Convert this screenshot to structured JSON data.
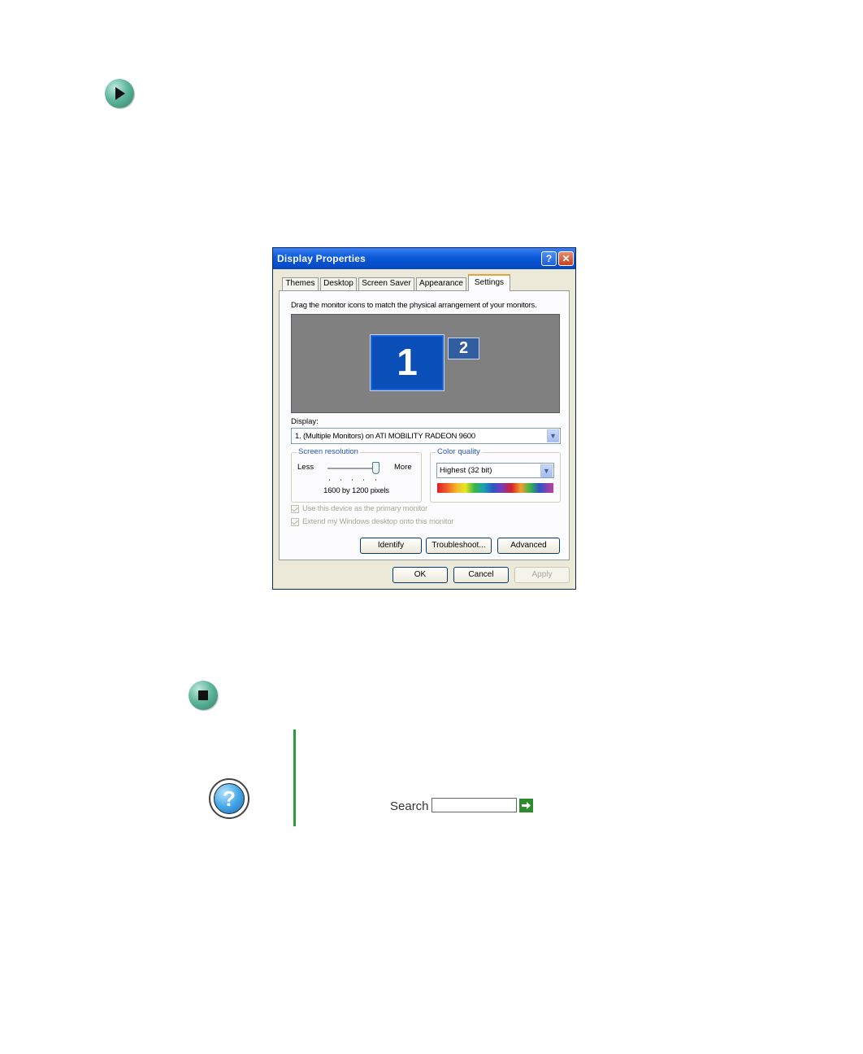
{
  "dialog": {
    "title": "Display Properties",
    "help_button": "?",
    "close_button": "✕",
    "tabs": [
      {
        "label": "Themes"
      },
      {
        "label": "Desktop"
      },
      {
        "label": "Screen Saver"
      },
      {
        "label": "Appearance"
      },
      {
        "label": "Settings",
        "active": true
      }
    ],
    "settings": {
      "instruction": "Drag the monitor icons to match the physical arrangement of your monitors.",
      "monitors": [
        "1",
        "2"
      ],
      "display_label": "Display:",
      "display_value": "1. (Multiple Monitors) on ATI MOBILITY RADEON 9600",
      "screen_resolution": {
        "legend": "Screen resolution",
        "less_label": "Less",
        "more_label": "More",
        "value": "1600 by 1200 pixels",
        "slider_level": 1.0
      },
      "color_quality": {
        "legend": "Color quality",
        "value": "Highest (32 bit)"
      },
      "checkboxes": [
        {
          "label": "Use this device as the primary monitor",
          "checked": true,
          "enabled": false
        },
        {
          "label": "Extend my Windows desktop onto this monitor",
          "checked": true,
          "enabled": false
        }
      ],
      "buttons": {
        "identify": "Identify",
        "troubleshoot": "Troubleshoot...",
        "advanced": "Advanced"
      }
    },
    "footer_buttons": {
      "ok": "OK",
      "cancel": "Cancel",
      "apply": "Apply"
    }
  },
  "help": {
    "search_label": "Search",
    "search_value": ""
  },
  "colors": {
    "accent_green": "#2a9d3a",
    "titlebar_blue": "#0a58d8",
    "monitor_blue": "#0a4fb8"
  },
  "icons": [
    "arrow-icon",
    "stop-icon",
    "help-icon",
    "go-arrow-icon",
    "dropdown-arrow-icon"
  ]
}
